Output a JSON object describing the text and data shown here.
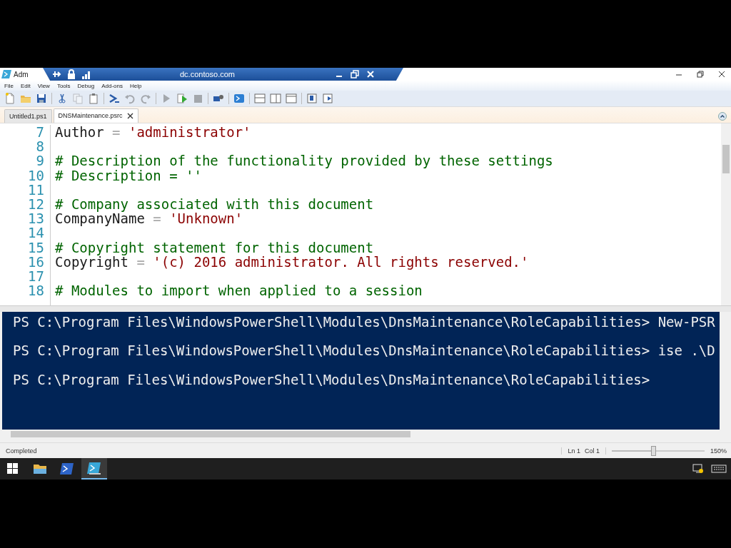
{
  "window": {
    "title": "Adm"
  },
  "remote_bar": {
    "title": "dc.contoso.com"
  },
  "menu": [
    "File",
    "Edit",
    "View",
    "Tools",
    "Debug",
    "Add-ons",
    "Help"
  ],
  "toolbar": [
    {
      "kind": "new",
      "disabled": false
    },
    {
      "kind": "open",
      "disabled": false
    },
    {
      "kind": "save",
      "disabled": false
    },
    {
      "kind": "cut",
      "disabled": false
    },
    {
      "kind": "copy",
      "disabled": true
    },
    {
      "kind": "paste",
      "disabled": false
    },
    {
      "kind": "prompt",
      "disabled": false
    },
    {
      "kind": "undo",
      "disabled": true
    },
    {
      "kind": "redo",
      "disabled": true
    },
    {
      "kind": "run",
      "disabled": true
    },
    {
      "kind": "run-selection",
      "disabled": false
    },
    {
      "kind": "stop",
      "disabled": true
    },
    {
      "kind": "remote",
      "disabled": false
    },
    {
      "kind": "powershell",
      "disabled": false
    },
    {
      "kind": "pane-top",
      "disabled": false
    },
    {
      "kind": "pane-right",
      "disabled": false
    },
    {
      "kind": "pane-max",
      "disabled": false
    },
    {
      "kind": "show-commands",
      "disabled": false
    },
    {
      "kind": "addon",
      "disabled": false
    }
  ],
  "tabs": [
    {
      "label": "Untitled1.ps1",
      "selected": false
    },
    {
      "label": "DNSMaintenance.psrc",
      "selected": true
    }
  ],
  "editor": {
    "lines": [
      {
        "number": "7",
        "tokens": [
          {
            "kind": "name",
            "text": "Author"
          },
          {
            "kind": "op",
            "text": " = "
          },
          {
            "kind": "string",
            "text": "'administrator'"
          }
        ]
      },
      {
        "number": "8"
      },
      {
        "number": "9",
        "tokens": [
          {
            "kind": "comment",
            "text": "# Description of the functionality provided by these settings"
          }
        ]
      },
      {
        "number": "10",
        "tokens": [
          {
            "kind": "comment",
            "text": "# Description = ''"
          }
        ]
      },
      {
        "number": "11"
      },
      {
        "number": "12",
        "tokens": [
          {
            "kind": "comment",
            "text": "# Company associated with this document"
          }
        ]
      },
      {
        "number": "13",
        "tokens": [
          {
            "kind": "name",
            "text": "CompanyName"
          },
          {
            "kind": "op",
            "text": " = "
          },
          {
            "kind": "string",
            "text": "'Unknown'"
          }
        ]
      },
      {
        "number": "14"
      },
      {
        "number": "15",
        "tokens": [
          {
            "kind": "comment",
            "text": "# Copyright statement for this document"
          }
        ]
      },
      {
        "number": "16",
        "tokens": [
          {
            "kind": "name",
            "text": "Copyright"
          },
          {
            "kind": "op",
            "text": " = "
          },
          {
            "kind": "string",
            "text": "'(c) 2016 administrator. All rights reserved.'"
          }
        ]
      },
      {
        "number": "17"
      },
      {
        "number": "18",
        "tokens": [
          {
            "kind": "comment",
            "text": "# Modules to import when applied to a session"
          }
        ]
      }
    ]
  },
  "console": {
    "lines": [
      "PS C:\\Program Files\\WindowsPowerShell\\Modules\\DnsMaintenance\\RoleCapabilities> New-PSR",
      "PS C:\\Program Files\\WindowsPowerShell\\Modules\\DnsMaintenance\\RoleCapabilities> ise .\\D",
      "PS C:\\Program Files\\WindowsPowerShell\\Modules\\DnsMaintenance\\RoleCapabilities>"
    ]
  },
  "status_bar": {
    "status": "Completed",
    "line": "Ln 1",
    "column": "Col 1",
    "zoom": {
      "level": 0.45
    },
    "zoom_reading": "150%"
  },
  "taskbar": [
    {
      "kind": "start",
      "selected": false
    },
    {
      "kind": "explorer",
      "selected": false
    },
    {
      "kind": "powershell",
      "selected": false
    },
    {
      "kind": "ise",
      "selected": true
    }
  ]
}
